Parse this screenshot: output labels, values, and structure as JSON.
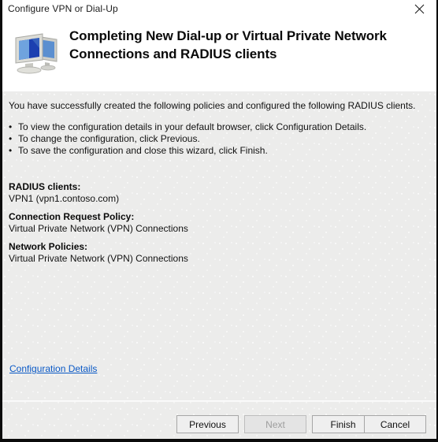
{
  "window": {
    "title": "Configure VPN or Dial-Up",
    "close_icon": "close-icon"
  },
  "header": {
    "icon": "network-computers-icon",
    "title": "Completing New Dial-up or Virtual Private Network Connections and RADIUS clients"
  },
  "body": {
    "intro": "You have successfully created the following policies and configured the following RADIUS clients.",
    "bullet_marker": "•",
    "bullets": [
      "To view the configuration details in your default browser, click Configuration Details.",
      "To change the configuration, click Previous.",
      "To save the configuration and close this wizard, click Finish."
    ],
    "summary": [
      {
        "label": "RADIUS clients:",
        "value": "VPN1 (vpn1.contoso.com)"
      },
      {
        "label": "Connection Request Policy:",
        "value": "Virtual Private Network (VPN) Connections"
      },
      {
        "label": "Network Policies:",
        "value": "Virtual Private Network (VPN) Connections"
      }
    ],
    "config_details_link": "Configuration Details"
  },
  "footer": {
    "buttons": [
      {
        "label": "Previous",
        "disabled": false
      },
      {
        "label": "Next",
        "disabled": true
      },
      {
        "label": "Finish",
        "disabled": false
      },
      {
        "label": "Cancel",
        "disabled": false
      }
    ]
  },
  "colors": {
    "link": "#0a59c6",
    "body_background": "#ececeb",
    "header_background": "#ffffff",
    "border": "#0b0b0b"
  }
}
